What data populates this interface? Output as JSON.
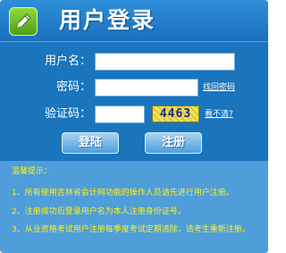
{
  "header": {
    "title": "用户登录",
    "logo_icon": "pen-icon"
  },
  "form": {
    "username_label": "用户名：",
    "username_value": "",
    "password_label": "密码：",
    "password_value": "",
    "forgot_password": "找回密码",
    "captcha_label": "验证码：",
    "captcha_value": "",
    "captcha_image_text": "4463",
    "captcha_refresh": "看不清?"
  },
  "buttons": {
    "login": "登陆",
    "register": "注册"
  },
  "tips": {
    "title": "温馨提示：",
    "items": [
      "1、所有使用吉林省会计网功能的操作人员请先进行用户注册。",
      "2、注册成功后登录用户名为本人注册身份证号。",
      "3、从业资格考试用户注册每季度考试定期清除，请考生重新注册。"
    ]
  },
  "colors": {
    "panel": "#1a75bd",
    "tips_bg": "#4f9ed9",
    "tips_text": "#ffef22",
    "logo": "#6fbd2a"
  }
}
